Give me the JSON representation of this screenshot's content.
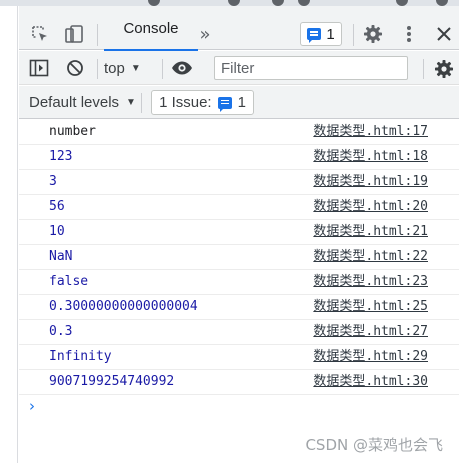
{
  "colors": {
    "accent": "#1a73e8",
    "string_text": "#202124",
    "number_text": "#1a1aa6",
    "toolbar_bg": "#f1f3f4"
  },
  "tabbar": {
    "console_tab_label": "Console",
    "more_tabs_label": "»",
    "messages_count": "1"
  },
  "toolbar": {
    "context_label": "top",
    "filter_placeholder": "Filter",
    "levels_label": "Default levels",
    "issues_label": "1 Issue:",
    "issues_count": "1"
  },
  "console": {
    "entries": [
      {
        "value": "number",
        "kind": "string",
        "source": "数据类型.html:17"
      },
      {
        "value": "123",
        "kind": "number",
        "source": "数据类型.html:18"
      },
      {
        "value": "3",
        "kind": "number",
        "source": "数据类型.html:19"
      },
      {
        "value": "56",
        "kind": "number",
        "source": "数据类型.html:20"
      },
      {
        "value": "10",
        "kind": "number",
        "source": "数据类型.html:21"
      },
      {
        "value": "NaN",
        "kind": "number",
        "source": "数据类型.html:22"
      },
      {
        "value": "false",
        "kind": "number",
        "source": "数据类型.html:23"
      },
      {
        "value": "0.30000000000000004",
        "kind": "number",
        "source": "数据类型.html:25"
      },
      {
        "value": "0.3",
        "kind": "number",
        "source": "数据类型.html:27"
      },
      {
        "value": "Infinity",
        "kind": "number",
        "source": "数据类型.html:29"
      },
      {
        "value": "9007199254740992",
        "kind": "number",
        "source": "数据类型.html:30"
      }
    ],
    "prompt_symbol": "›"
  },
  "watermark": "CSDN @菜鸡也会飞"
}
